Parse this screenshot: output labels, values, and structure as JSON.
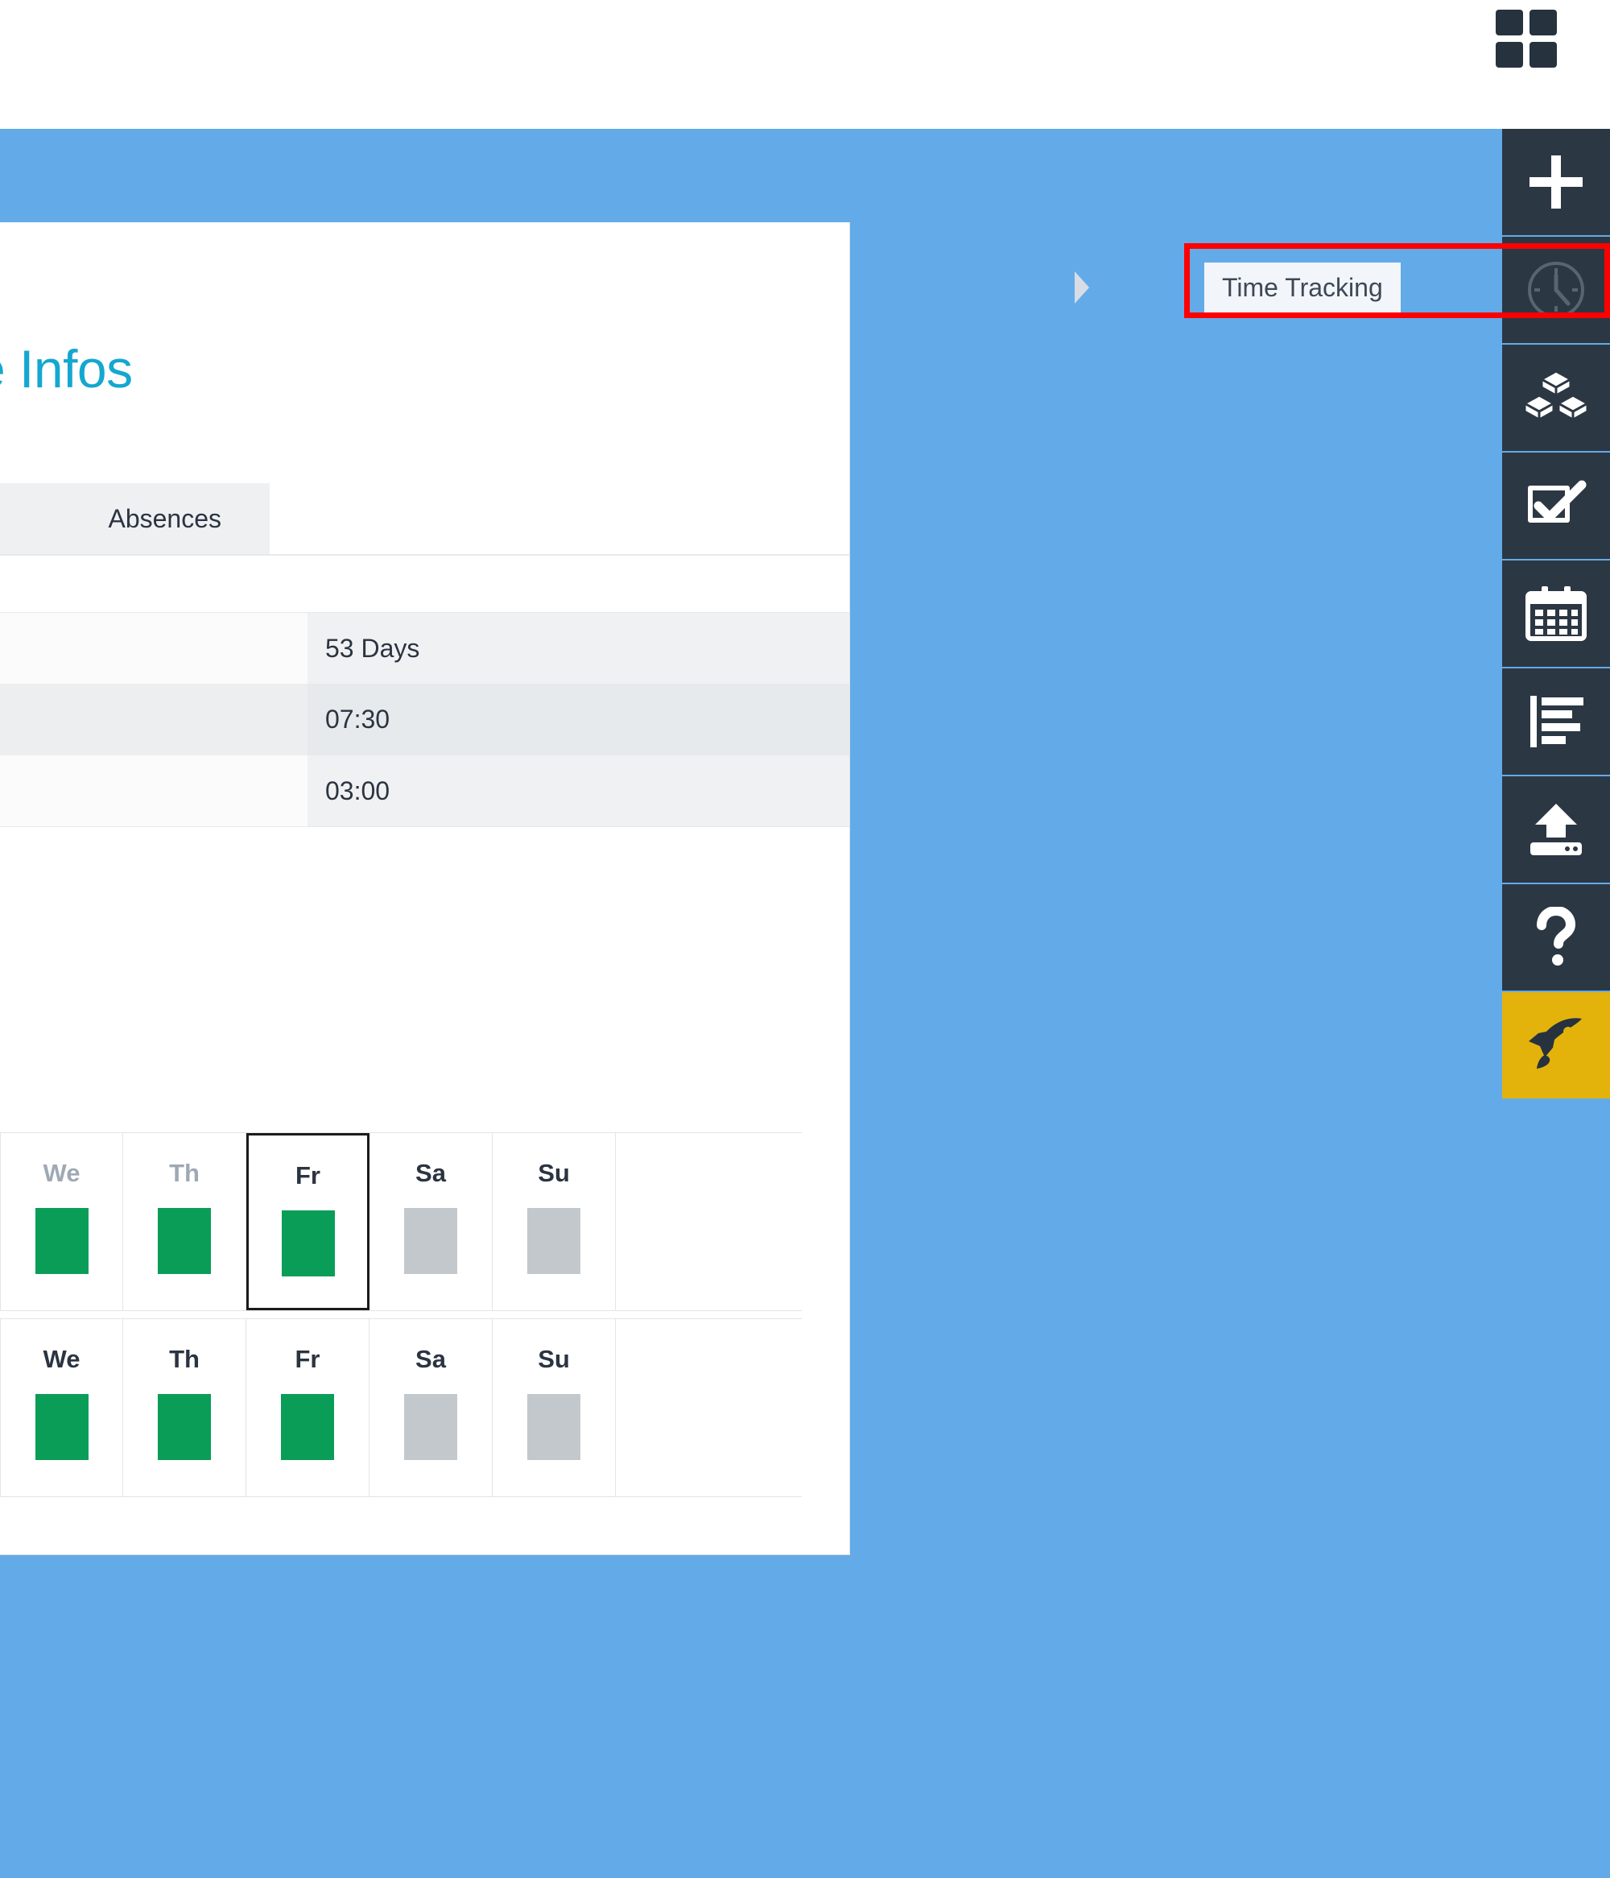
{
  "top_bar": {
    "app_launcher_icon": "grid-2x2-icon"
  },
  "window": {
    "selector_chevron_icon": "chevron-down-icon"
  },
  "page": {
    "title": "e Infos",
    "tabs": [
      {
        "label": "Absences",
        "selected": true
      }
    ]
  },
  "summary_table": {
    "rows": [
      {
        "label": "",
        "value": "53 Days"
      },
      {
        "label": "",
        "value": "07:30"
      },
      {
        "label": "",
        "value": "03:00"
      }
    ]
  },
  "week_strips": [
    {
      "name": "week-row-1",
      "days": [
        {
          "label": "We",
          "box": "green",
          "faded": true,
          "selected": false
        },
        {
          "label": "Th",
          "box": "green",
          "faded": true,
          "selected": false
        },
        {
          "label": "Fr",
          "box": "green",
          "faded": false,
          "selected": true
        },
        {
          "label": "Sa",
          "box": "gray",
          "faded": false,
          "selected": false
        },
        {
          "label": "Su",
          "box": "gray",
          "faded": false,
          "selected": false
        }
      ]
    },
    {
      "name": "week-row-2",
      "days": [
        {
          "label": "We",
          "box": "green",
          "faded": false,
          "selected": false
        },
        {
          "label": "Th",
          "box": "green",
          "faded": false,
          "selected": false
        },
        {
          "label": "Fr",
          "box": "green",
          "faded": false,
          "selected": false
        },
        {
          "label": "Sa",
          "box": "gray",
          "faded": false,
          "selected": false
        },
        {
          "label": "Su",
          "box": "gray",
          "faded": false,
          "selected": false
        }
      ]
    }
  ],
  "icon_rail": {
    "items": [
      {
        "icon": "plus-icon",
        "name": "add",
        "accent": false
      },
      {
        "icon": "clock-icon",
        "name": "time-tracking",
        "accent": false
      },
      {
        "icon": "blocks-icon",
        "name": "modules",
        "accent": false
      },
      {
        "icon": "checkbox-icon",
        "name": "tasks",
        "accent": false
      },
      {
        "icon": "calendar-icon",
        "name": "calendar",
        "accent": false
      },
      {
        "icon": "bar-list-icon",
        "name": "reports",
        "accent": false
      },
      {
        "icon": "upload-icon",
        "name": "upload",
        "accent": false
      },
      {
        "icon": "question-icon",
        "name": "help",
        "accent": false
      },
      {
        "icon": "rocket-icon",
        "name": "launch",
        "accent": true
      }
    ]
  },
  "annotation": {
    "tooltip_label": "Time Tracking",
    "highlight_color": "#ff0000"
  },
  "colors": {
    "desktop_blue": "#63abe8",
    "selector_blue": "#a8cdee",
    "title_cyan": "#14a7d0",
    "rail_dark": "#2c3744",
    "rail_accent": "#e3b30c",
    "day_green": "#0a9d58",
    "day_gray": "#c3c8cd"
  }
}
